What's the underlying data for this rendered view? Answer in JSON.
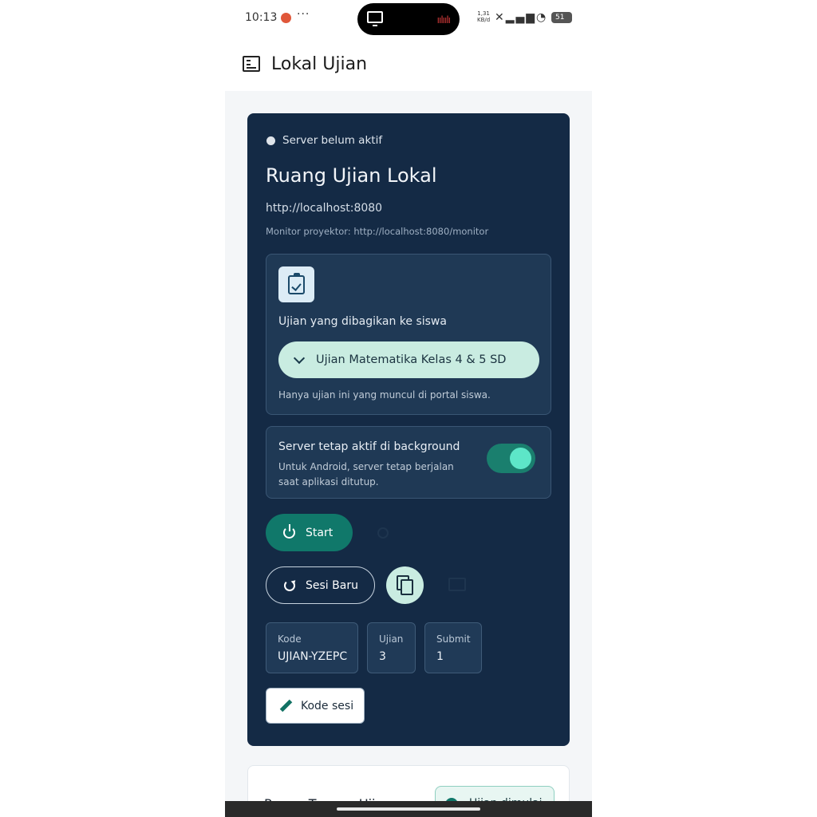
{
  "status_bar": {
    "time": "10:13",
    "dots": "···",
    "speed_value": "1,31",
    "speed_unit": "KB/d",
    "battery": "51"
  },
  "app_bar": {
    "title": "Lokal Ujian",
    "icon": "checklist-icon"
  },
  "server_card": {
    "status": "Server belum aktif",
    "title": "Ruang Ujian Lokal",
    "url": "http://localhost:8080",
    "monitor": "Monitor proyektor: http://localhost:8080/monitor",
    "exam_section": {
      "icon": "clipboard-check-icon",
      "label": "Ujian yang dibagikan ke siswa",
      "selected_exam": "Ujian Matematika Kelas 4 & 5 SD",
      "help": "Hanya ujian ini yang muncul di portal siswa."
    },
    "background_section": {
      "title": "Server tetap aktif di background",
      "description": "Untuk Android, server tetap berjalan saat aplikasi ditutup.",
      "enabled": true
    },
    "start_label": "Start",
    "new_session_label": "Sesi Baru",
    "stats": {
      "kode_label": "Kode",
      "kode_value": "UJIAN-YZEPC",
      "ujian_label": "Ujian",
      "ujian_value": "3",
      "submit_label": "Submit",
      "submit_value": "1"
    },
    "edit_code_label": "Kode sesi"
  },
  "waiting_card": {
    "title": "Ruang Tunggu Ujian",
    "chip_label": "Ujian dimulai"
  },
  "colors": {
    "card_bg": "#142a45",
    "accent": "#10786a",
    "chip": "#c9ece1",
    "toggle_knob": "#5de6c8"
  }
}
